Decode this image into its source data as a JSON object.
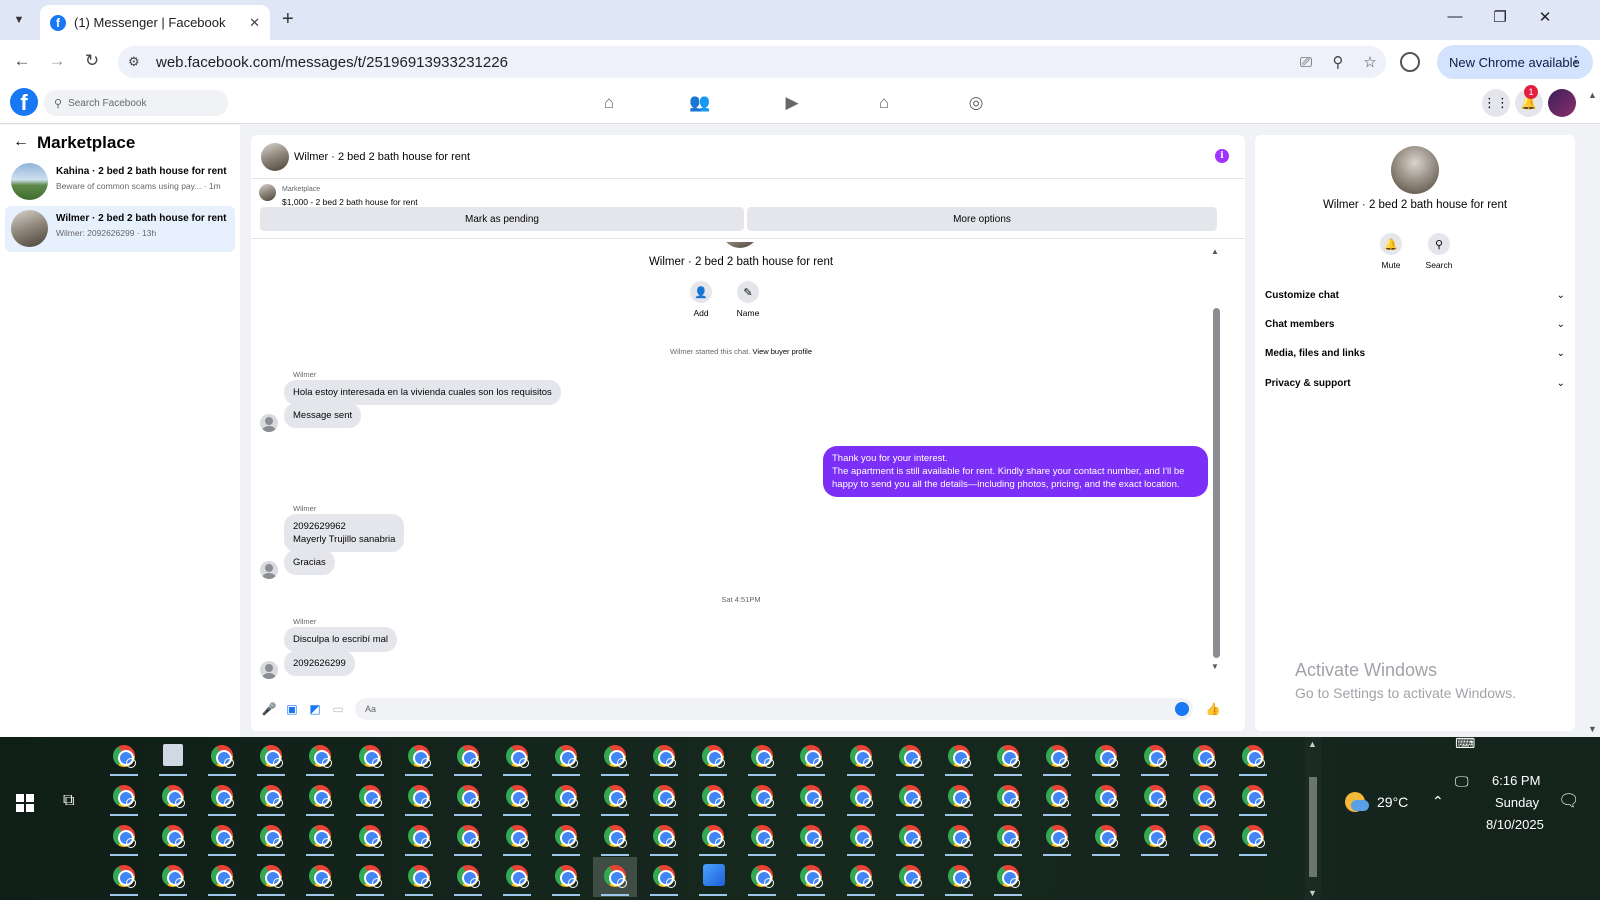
{
  "browser": {
    "tab_title": "(1) Messenger | Facebook",
    "url": "web.facebook.com/messages/t/25196913933231226",
    "new_chrome_label": "New Chrome available"
  },
  "fb": {
    "search_placeholder": "Search Facebook",
    "notification_count": "1",
    "nav_icons": [
      "home-icon",
      "friends-icon",
      "video-icon",
      "marketplace-icon",
      "groups-icon"
    ]
  },
  "sidebar": {
    "title": "Marketplace",
    "conversations": [
      {
        "name": "Kahina · 2 bed 2 bath house for rent",
        "preview": "Beware of common scams using pay... · 1m"
      },
      {
        "name": "Wilmer · 2 bed 2 bath house for rent",
        "preview": "Wilmer: 2092626299 · 13h"
      }
    ]
  },
  "chat": {
    "header_name": "Wilmer · 2 bed 2 bath house for rent",
    "listing_category": "Marketplace",
    "listing_price_title": "$1,000 - 2 bed 2 bath house for rent",
    "mark_pending_label": "Mark as pending",
    "more_options_label": "More options",
    "profile_name": "Wilmer · 2 bed 2 bath house for rent",
    "add_label": "Add",
    "name_label": "Name",
    "started_text": "Wilmer started this chat.",
    "view_buyer_profile": "View buyer profile",
    "messages": [
      {
        "sender": "Wilmer",
        "text": "Hola estoy interesada en la vivienda cuales son los requisitos"
      },
      {
        "text": "Message sent"
      },
      {
        "line1": "Thank you for your interest.",
        "line2": "The apartment is still available for rent. Kindly share your contact number, and I'll be",
        "line3": "happy to send you all the details—including photos, pricing, and the exact location."
      },
      {
        "sender": "Wilmer",
        "line1": "2092629962",
        "line2": "Mayerly Trujillo sanabria"
      },
      {
        "text": "Gracias"
      },
      {
        "timestamp": "Sat 4:51PM"
      },
      {
        "sender": "Wilmer",
        "text": "Disculpa lo escribí mal"
      },
      {
        "text": "2092626299"
      }
    ],
    "composer_placeholder": "Aa"
  },
  "info_panel": {
    "name": "Wilmer · 2 bed 2 bath house for rent",
    "mute_label": "Mute",
    "search_label": "Search",
    "sections": [
      "Customize chat",
      "Chat members",
      "Media, files and links",
      "Privacy & support"
    ]
  },
  "watermark": {
    "line1": "Activate Windows",
    "line2": "Go to Settings to activate Windows."
  },
  "taskbar": {
    "temperature": "29°C",
    "time": "6:16 PM",
    "day": "Sunday",
    "date": "8/10/2025"
  },
  "colors": {
    "fb_blue": "#1877f2",
    "own_bubble": "#7b2ff7",
    "active_conversation": "#e7f0fd",
    "notification_badge": "#e41e3f"
  }
}
